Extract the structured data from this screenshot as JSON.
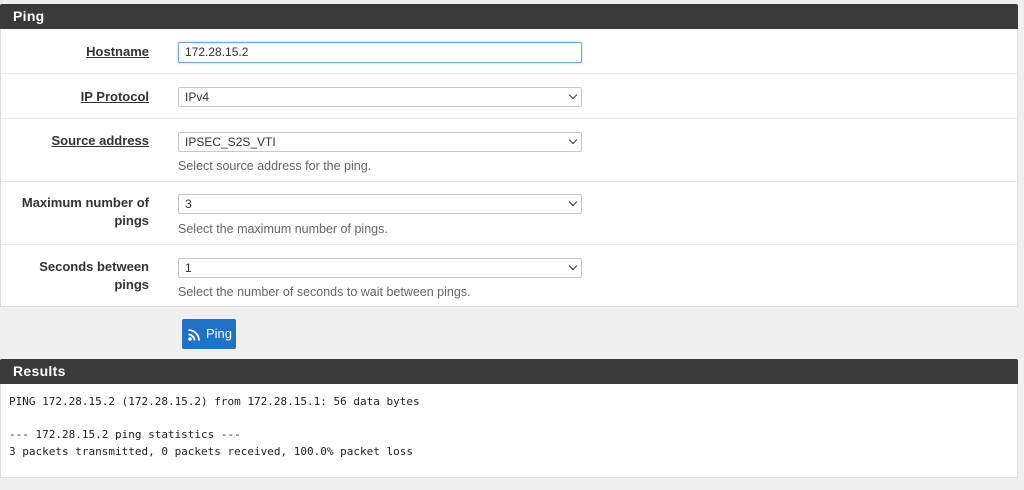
{
  "ping_panel": {
    "title": "Ping",
    "hostname": {
      "label": "Hostname",
      "value": "172.28.15.2"
    },
    "ip_protocol": {
      "label": "IP Protocol",
      "value": "IPv4"
    },
    "source_address": {
      "label": "Source address",
      "value": "IPSEC_S2S_VTI",
      "help": "Select source address for the ping."
    },
    "max_pings": {
      "label_line1": "Maximum number of",
      "label_line2": "pings",
      "value": "3",
      "help": "Select the maximum number of pings."
    },
    "seconds_between": {
      "label": "Seconds between pings",
      "value": "1",
      "help": "Select the number of seconds to wait between pings."
    }
  },
  "ping_button": {
    "label": "Ping",
    "icon": "rss-icon",
    "color": "#1e73c8"
  },
  "results_panel": {
    "title": "Results",
    "lines": [
      "PING 172.28.15.2 (172.28.15.2) from 172.28.15.1: 56 data bytes",
      "",
      "--- 172.28.15.2 ping statistics ---",
      "3 packets transmitted, 0 packets received, 100.0% packet loss"
    ]
  }
}
